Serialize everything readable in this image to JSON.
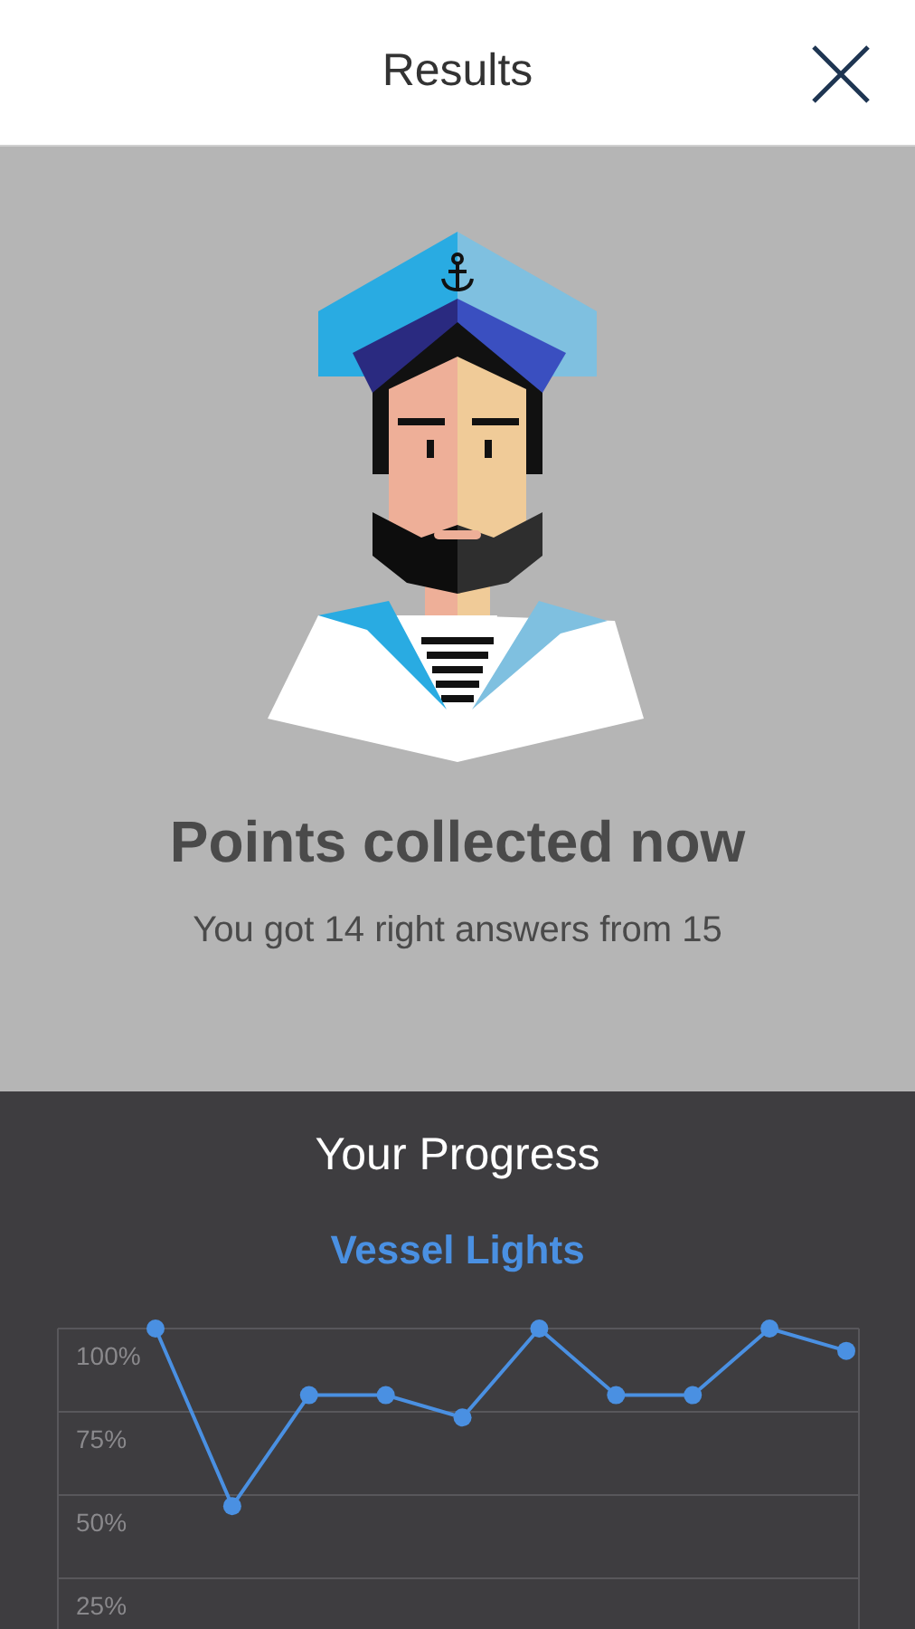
{
  "header": {
    "title": "Results"
  },
  "result": {
    "heading": "Points collected now",
    "summary": "You got 14 right answers from 15"
  },
  "progress": {
    "title": "Your Progress",
    "chart_data": {
      "type": "line",
      "title": "Vessel Lights",
      "series": [
        {
          "color": "#4a90e2",
          "marker": "circle",
          "values": [
            100,
            46.7,
            80,
            80,
            73.3,
            100,
            80,
            80,
            100,
            93.3
          ]
        }
      ],
      "ylim": [
        25,
        100
      ],
      "yticks": [
        {
          "value": 100,
          "label": "100%"
        },
        {
          "value": 75,
          "label": "75%"
        },
        {
          "value": 50,
          "label": "50%"
        },
        {
          "value": 25,
          "label": "25%"
        }
      ]
    }
  }
}
